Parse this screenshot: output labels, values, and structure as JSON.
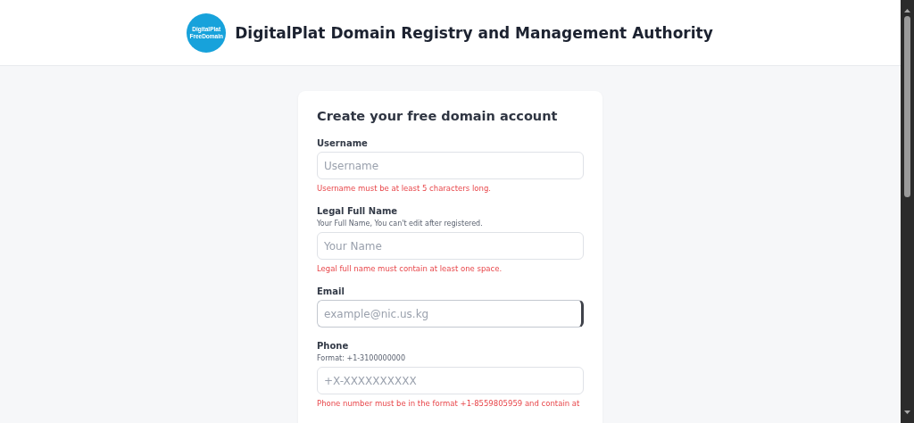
{
  "header": {
    "logo_lines": [
      "DigitalPlat",
      "FreeDomain"
    ],
    "title": "DigitalPlat Domain Registry and Management Authority"
  },
  "form": {
    "title": "Create your free domain account",
    "fields": [
      {
        "label": "Username",
        "placeholder": "Username",
        "focused": false,
        "error": "Username must be at least 5 characters long."
      },
      {
        "label": "Legal Full Name",
        "hint": "Your Full Name, You can't edit after registered.",
        "placeholder": "Your Name",
        "focused": false,
        "error": "Legal full name must contain at least one space."
      },
      {
        "label": "Email",
        "placeholder": "example@nic.us.kg",
        "focused": true
      },
      {
        "label": "Phone",
        "hint": "Format: +1-3100000000",
        "placeholder": "+X-XXXXXXXXXX",
        "focused": false,
        "error": "Phone number must be in the format +1-8559805959 and contain at"
      }
    ]
  }
}
